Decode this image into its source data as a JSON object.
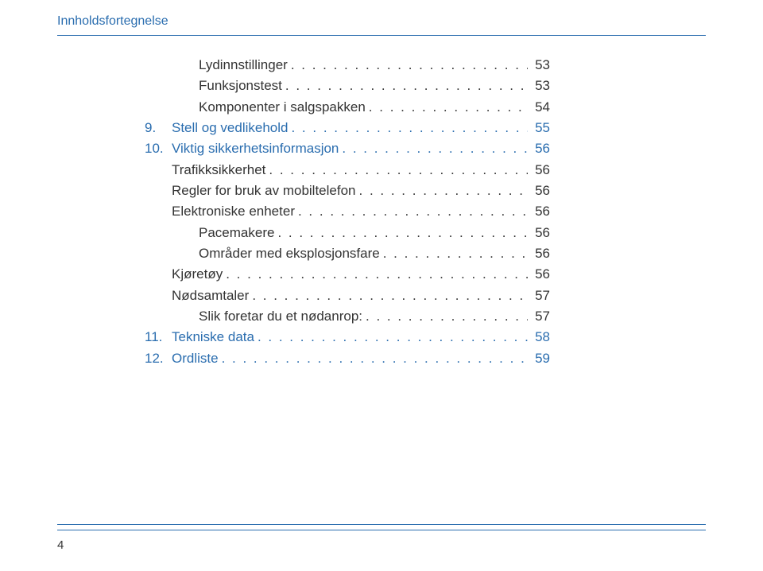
{
  "header": {
    "title": "Innholdsfortegnelse"
  },
  "toc": [
    {
      "level": 2,
      "label": "Lydinnstillinger",
      "page": "53",
      "blue": false
    },
    {
      "level": 2,
      "label": "Funksjonstest",
      "page": "53",
      "blue": false
    },
    {
      "level": 2,
      "label": "Komponenter i salgspakken",
      "page": "54",
      "blue": false
    },
    {
      "level": 0,
      "num": "9.",
      "label": "Stell og vedlikehold",
      "page": "55",
      "blue": true
    },
    {
      "level": 0,
      "num": "10.",
      "label": "Viktig sikkerhetsinformasjon",
      "page": "56",
      "blue": true
    },
    {
      "level": 1,
      "label": "Trafikksikkerhet",
      "page": "56",
      "blue": false
    },
    {
      "level": 1,
      "label": "Regler for bruk av mobiltelefon",
      "page": "56",
      "blue": false
    },
    {
      "level": 1,
      "label": "Elektroniske enheter",
      "page": "56",
      "blue": false
    },
    {
      "level": 2,
      "label": "Pacemakere",
      "page": "56",
      "blue": false
    },
    {
      "level": 2,
      "label": "Områder med eksplosjonsfare",
      "page": "56",
      "blue": false
    },
    {
      "level": 1,
      "label": "Kjøretøy",
      "page": "56",
      "blue": false
    },
    {
      "level": 1,
      "label": "Nødsamtaler",
      "page": "57",
      "blue": false
    },
    {
      "level": 2,
      "label": "Slik foretar du et nødanrop:",
      "page": "57",
      "blue": false
    },
    {
      "level": 0,
      "num": "11.",
      "label": "Tekniske data",
      "page": "58",
      "blue": true
    },
    {
      "level": 0,
      "num": "12.",
      "label": "Ordliste",
      "page": "59",
      "blue": true
    }
  ],
  "footer": {
    "pageNumber": "4"
  },
  "dots": ". . . . . . . . . . . . . . . . . . . . . . . . . . . . . . . . . . . . . . . . . . . . . . . . . . . . . . . . . . . . . . . . . . . . . . ."
}
